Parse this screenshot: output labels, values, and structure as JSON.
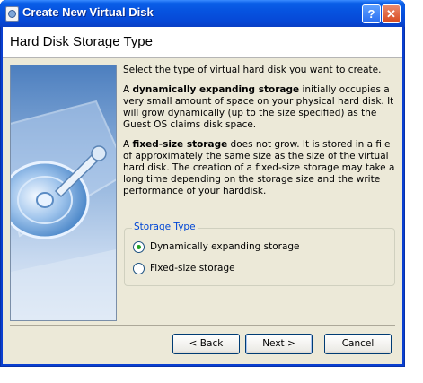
{
  "window": {
    "title": "Create New Virtual Disk",
    "help_label": "?",
    "close_label": "✕"
  },
  "header": {
    "title": "Hard Disk Storage Type"
  },
  "content": {
    "intro": "Select the type of virtual hard disk you want to create.",
    "dynamic_prefix": "A ",
    "dynamic_bold": "dynamically expanding storage",
    "dynamic_rest": " initially occupies a very small amount of space on your physical hard disk. It will grow dynamically (up to the size specified) as the Guest OS claims disk space.",
    "fixed_prefix": "A ",
    "fixed_bold": "fixed-size storage",
    "fixed_rest": " does not grow. It is stored in a file of approximately the same size as the size of the virtual hard disk. The creation of a fixed-size storage may take a long time depending on the storage size and the write performance of your harddisk."
  },
  "storage_type": {
    "legend": "Storage Type",
    "options": [
      {
        "label": "Dynamically expanding storage",
        "checked": true
      },
      {
        "label": "Fixed-size storage",
        "checked": false
      }
    ]
  },
  "buttons": {
    "back": "< Back",
    "next": "Next >",
    "cancel": "Cancel"
  },
  "colors": {
    "titlebar": "#0a5fe8",
    "dialog_bg": "#ece9d8",
    "legend_text": "#0046d5"
  },
  "icons": {
    "app": "virtual-disk-app-icon",
    "illustration": "hard-disk-illustration"
  }
}
